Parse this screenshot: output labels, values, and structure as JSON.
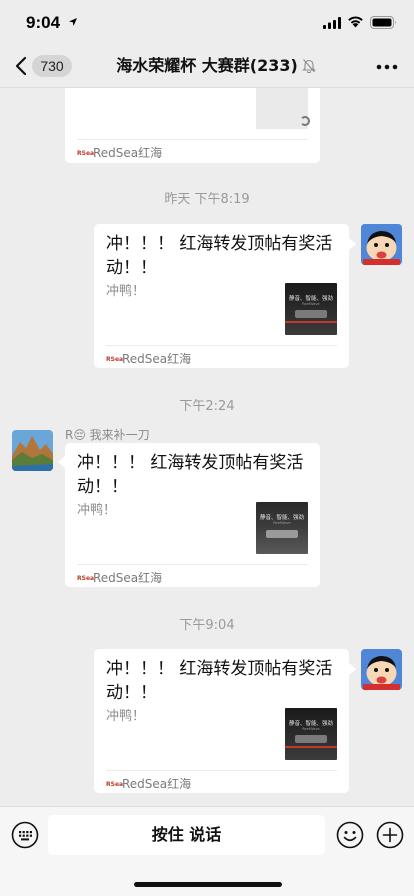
{
  "status_bar": {
    "time": "9:04"
  },
  "nav": {
    "unread_count": "730",
    "title": "海水荣耀杯 大赛群(233)"
  },
  "messages": {
    "partial_card": {
      "footer": "RedSea红海"
    },
    "ts1": "昨天 下午8:19",
    "card1": {
      "title": "冲！！！ 红海转发顶帖有奖活动！！",
      "desc": "冲鸭！",
      "thumb_caption": "静音、智能、强劲",
      "thumb_sub": "ReefWave",
      "footer": "RedSea红海"
    },
    "ts2": "下午2:24",
    "sender2": {
      "name": "R😔 我来补一刀"
    },
    "card2": {
      "title": "冲！！！ 红海转发顶帖有奖活动！！",
      "desc": "冲鸭！",
      "thumb_caption": "静音、智能、强劲",
      "thumb_sub": "ReefWave",
      "footer": "RedSea红海"
    },
    "ts3": "下午9:04",
    "card3": {
      "title": "冲！！！ 红海转发顶帖有奖活动！！",
      "desc": "冲鸭！",
      "thumb_caption": "静音、智能、强劲",
      "thumb_sub": "ReefWave",
      "footer": "RedSea红海"
    }
  },
  "input_bar": {
    "hold_to_talk": "按住 说话"
  },
  "icons": {
    "back": "back-chevron-icon",
    "mute": "mute-bell-icon",
    "more": "more-dots-icon",
    "keyboard": "voice-keyboard-icon",
    "emoji": "emoji-icon",
    "plus": "plus-icon",
    "brand_logo": "redsea-logo-icon"
  },
  "colors": {
    "chat_bg": "#ededed",
    "card_bg": "#ffffff",
    "timestamp": "#9a9a9a",
    "desc": "#8d8d8d"
  }
}
